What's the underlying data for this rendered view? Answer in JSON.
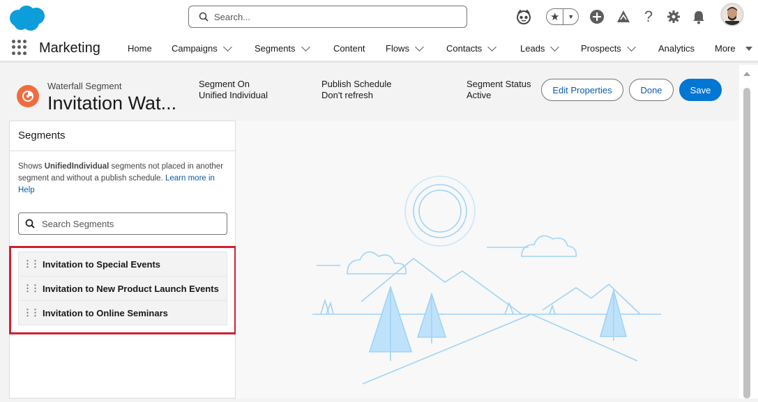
{
  "search": {
    "placeholder": "Search..."
  },
  "nav": {
    "app_name": "Marketing",
    "items": [
      {
        "label": "Home"
      },
      {
        "label": "Campaigns"
      },
      {
        "label": "Segments"
      },
      {
        "label": "Content"
      },
      {
        "label": "Flows"
      },
      {
        "label": "Contacts"
      },
      {
        "label": "Leads"
      },
      {
        "label": "Prospects"
      },
      {
        "label": "Analytics"
      },
      {
        "label": "More"
      }
    ]
  },
  "record": {
    "type": "Waterfall Segment",
    "title": "Invitation Wat...",
    "fields": [
      {
        "label": "Segment On",
        "value": "Unified Individual"
      },
      {
        "label": "Publish Schedule",
        "value": "Don't refresh"
      },
      {
        "label": "Segment Status",
        "value": "Active"
      }
    ],
    "buttons": {
      "edit": "Edit Properties",
      "done": "Done",
      "save": "Save"
    }
  },
  "panel": {
    "title": "Segments",
    "desc_prefix": "Shows ",
    "desc_bold": "UnifiedIndividual",
    "desc_middle": " segments not placed in another segment and without a publish schedule. ",
    "desc_link": "Learn more in Help",
    "search_placeholder": "Search Segments",
    "segments": [
      {
        "label": "Invitation to Special Events"
      },
      {
        "label": "Invitation to New Product Launch Events"
      },
      {
        "label": "Invitation to Online Seminars"
      }
    ]
  },
  "colors": {
    "brand": "#0176d3",
    "highlight": "#d0202e",
    "segment_icon": "#f06c3f",
    "illustration": "#8ecbf5"
  }
}
